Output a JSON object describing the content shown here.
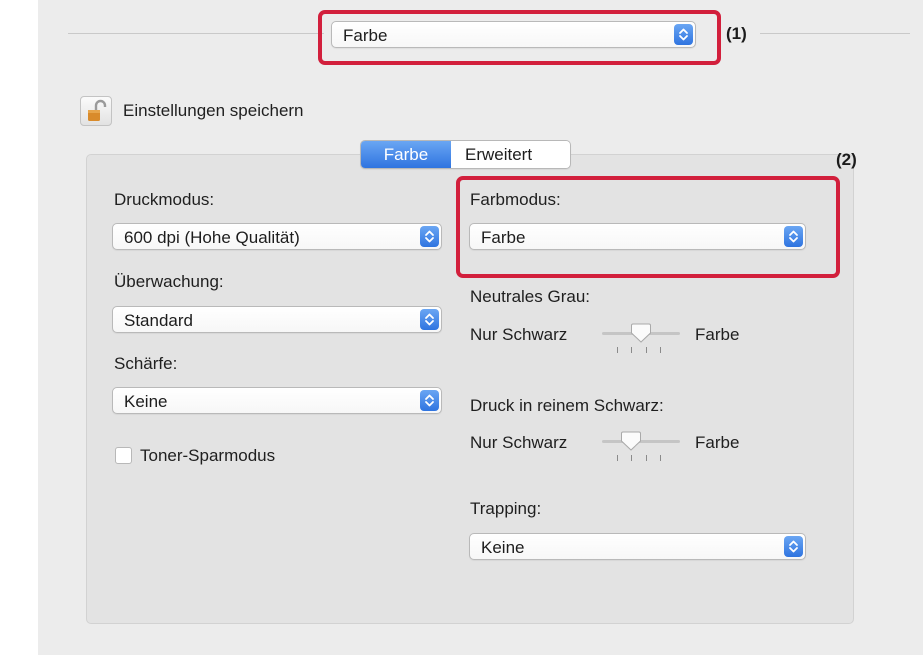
{
  "preset_popup": {
    "value": "Farbe",
    "callout": "(1)"
  },
  "lock": {
    "label": "Einstellungen speichern"
  },
  "tabs": [
    {
      "label": "Farbe",
      "active": true
    },
    {
      "label": "Erweitert",
      "active": false
    }
  ],
  "callout2": "(2)",
  "left": {
    "druckmodus": {
      "label": "Druckmodus:",
      "value": "600 dpi (Hohe Qualität)"
    },
    "ueberwachung": {
      "label": "Überwachung:",
      "value": "Standard"
    },
    "schaerfe": {
      "label": "Schärfe:",
      "value": "Keine"
    },
    "toner": {
      "label": "Toner-Sparmodus",
      "checked": false
    }
  },
  "right": {
    "farbmodus": {
      "label": "Farbmodus:",
      "value": "Farbe"
    },
    "neutrales_grau": {
      "label": "Neutrales Grau:",
      "min_label": "Nur Schwarz",
      "max_label": "Farbe",
      "level_fraction": 0.5
    },
    "reinem_schwarz": {
      "label": "Druck in reinem Schwarz:",
      "min_label": "Nur Schwarz",
      "max_label": "Farbe",
      "level_fraction": 0.5
    },
    "trapping": {
      "label": "Trapping:",
      "value": "Keine"
    }
  },
  "colors": {
    "accent": "#3a7ee6",
    "callout_box": "#d21f3c",
    "panel": "#e3e3e3",
    "window": "#ececec"
  },
  "icons": {
    "lock": "unlocked-padlock-icon",
    "popup_arrows": "up-down-chevron-icon"
  }
}
